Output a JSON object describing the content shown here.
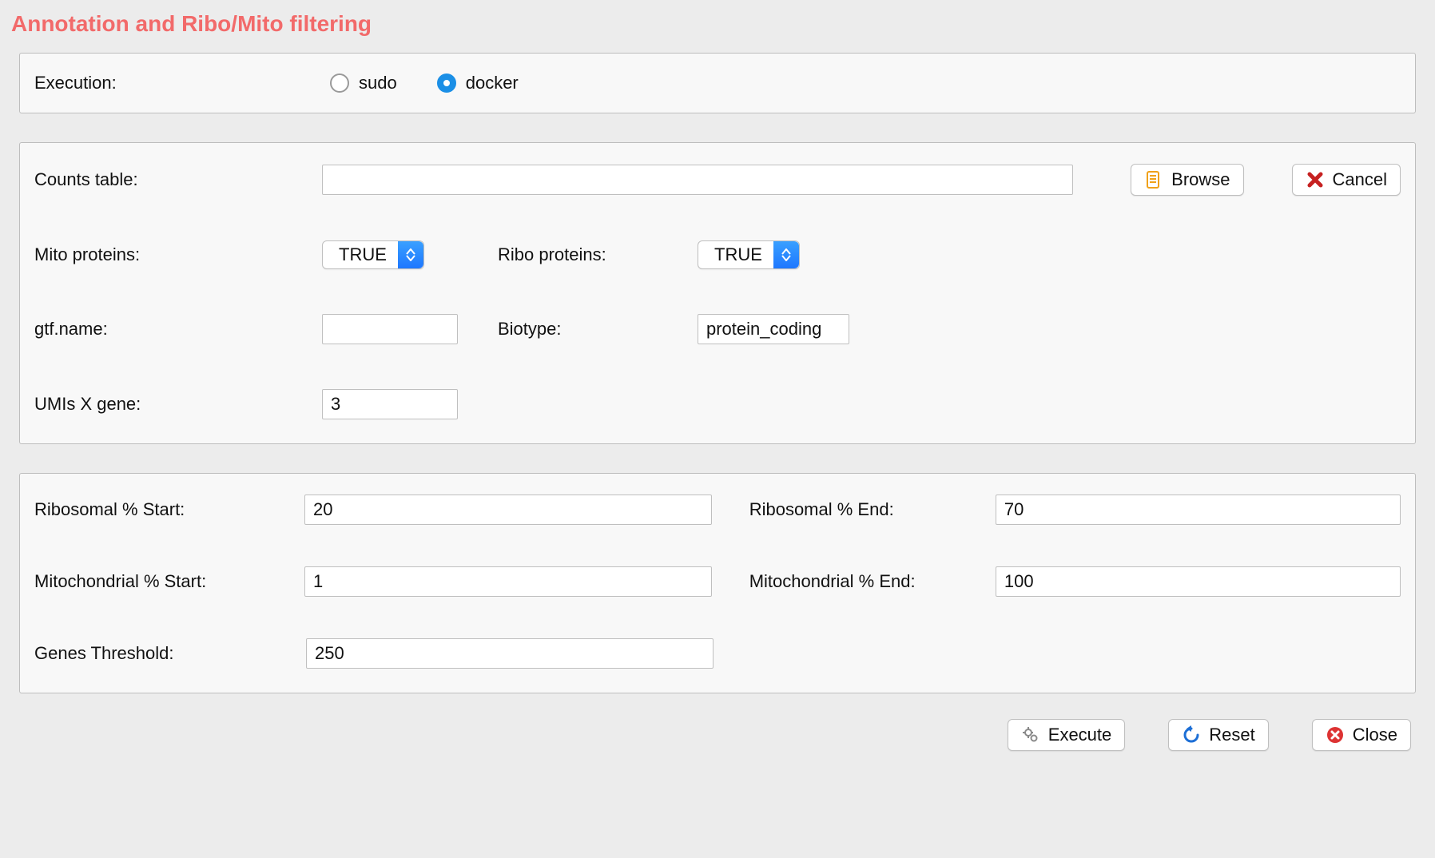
{
  "title": "Annotation and Ribo/Mito filtering",
  "execution": {
    "label": "Execution:",
    "options": {
      "sudo": "sudo",
      "docker": "docker"
    },
    "selected": "docker"
  },
  "section_params": {
    "counts_table": {
      "label": "Counts table:",
      "value": ""
    },
    "browse_label": "Browse",
    "cancel_label": "Cancel",
    "mito_proteins": {
      "label": "Mito proteins:",
      "value": "TRUE"
    },
    "ribo_proteins": {
      "label": "Ribo proteins:",
      "value": "TRUE"
    },
    "gtf_name": {
      "label": "gtf.name:",
      "value": ""
    },
    "biotype": {
      "label": "Biotype:",
      "value": "protein_coding"
    },
    "umis_x_gene": {
      "label": "UMIs X gene:",
      "value": "3"
    }
  },
  "section_thresholds": {
    "ribosomal_start": {
      "label": "Ribosomal % Start:",
      "value": "20"
    },
    "ribosomal_end": {
      "label": "Ribosomal % End:",
      "value": "70"
    },
    "mitochondrial_start": {
      "label": "Mitochondrial % Start:",
      "value": "1"
    },
    "mitochondrial_end": {
      "label": "Mitochondrial % End:",
      "value": "100"
    },
    "genes_threshold": {
      "label": "Genes Threshold:",
      "value": "250"
    }
  },
  "footer": {
    "execute": "Execute",
    "reset": "Reset",
    "close": "Close"
  }
}
